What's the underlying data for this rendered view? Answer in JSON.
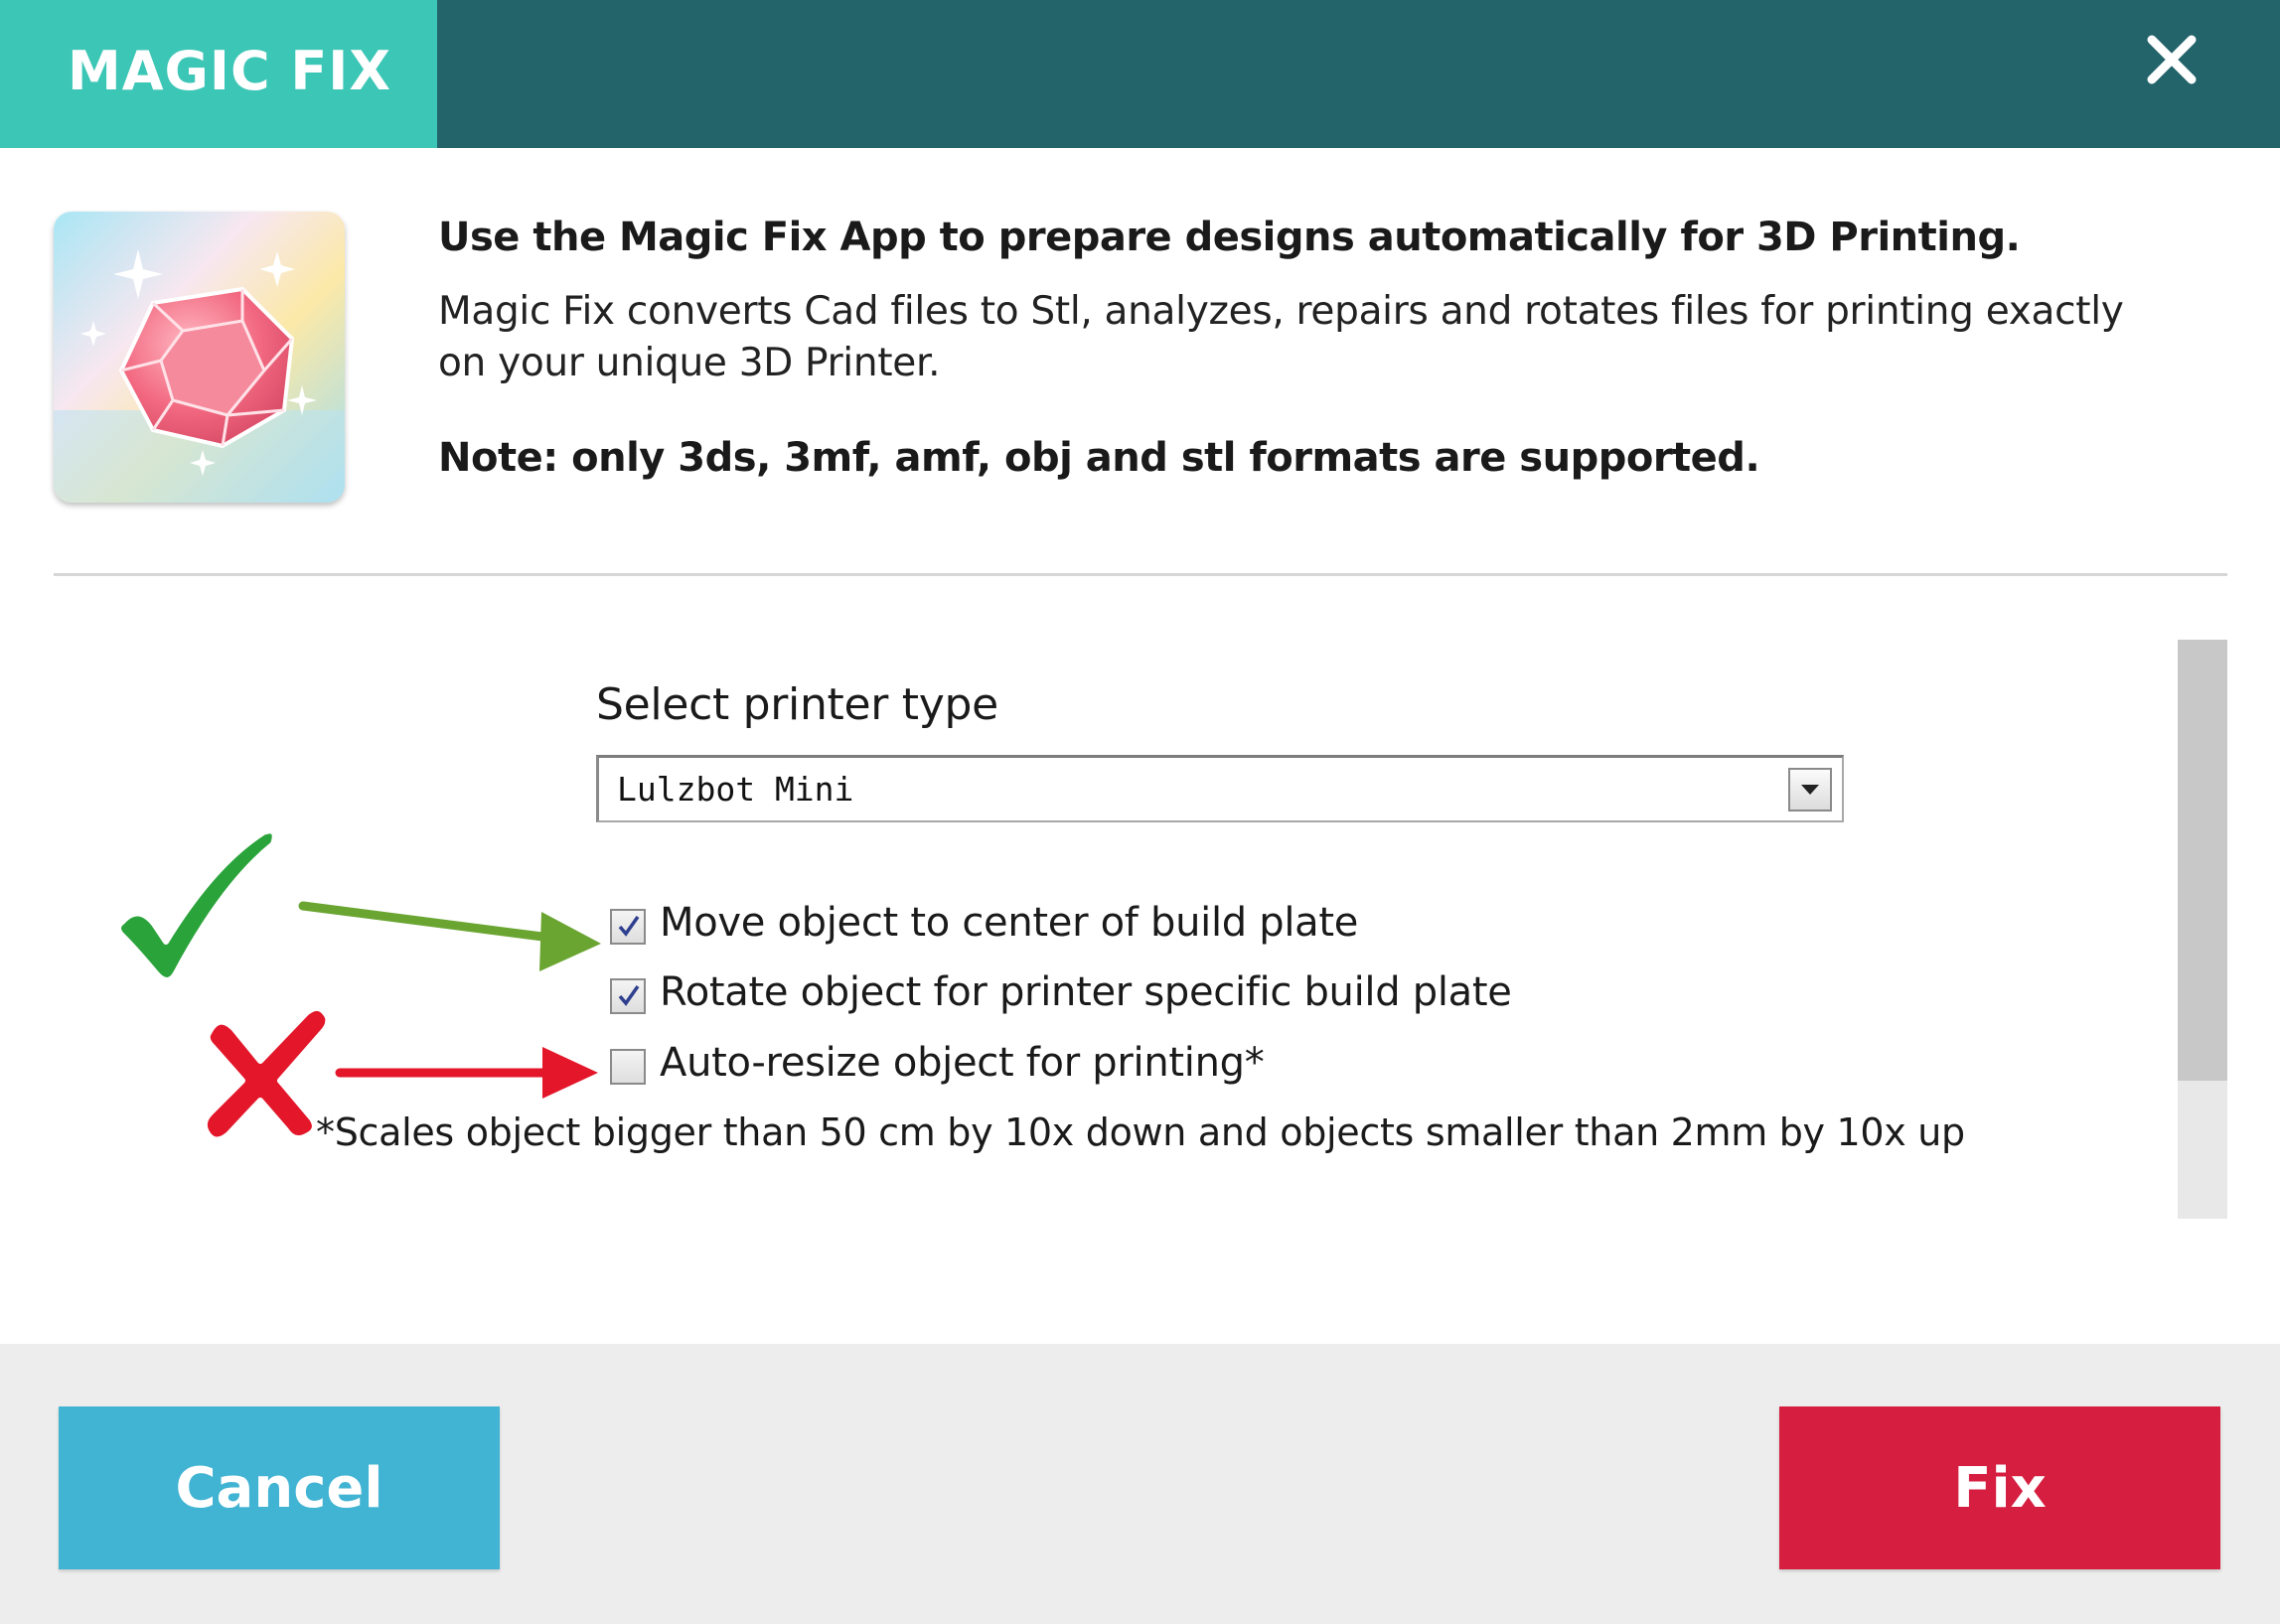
{
  "dialog": {
    "title": "MAGIC FIX",
    "close_icon": "close-icon"
  },
  "info": {
    "headline": "Use the Magic Fix App to prepare designs automatically for 3D Printing.",
    "description": "Magic Fix converts Cad files to Stl, analyzes, repairs and rotates files for printing exactly on your unique 3D Printer.",
    "note": "Note: only 3ds, 3mf, amf, obj and stl formats are supported."
  },
  "printer": {
    "label": "Select printer type",
    "selected": "Lulzbot Mini"
  },
  "options": [
    {
      "label": "Move object to center of build plate",
      "checked": true
    },
    {
      "label": "Rotate object for printer specific build plate",
      "checked": true
    },
    {
      "label": "Auto-resize object for printing*",
      "checked": false
    }
  ],
  "footnote": "*Scales object bigger than 50 cm by 10x down and objects smaller than 2mm by 10x up",
  "buttons": {
    "cancel": "Cancel",
    "fix": "Fix"
  },
  "colors": {
    "title_tab": "#3cc6b6",
    "title_bar": "#23636a",
    "cancel": "#41b3d3",
    "fix": "#d61e40",
    "annotation_check": "#2aa33a",
    "annotation_cross": "#e3162a"
  }
}
